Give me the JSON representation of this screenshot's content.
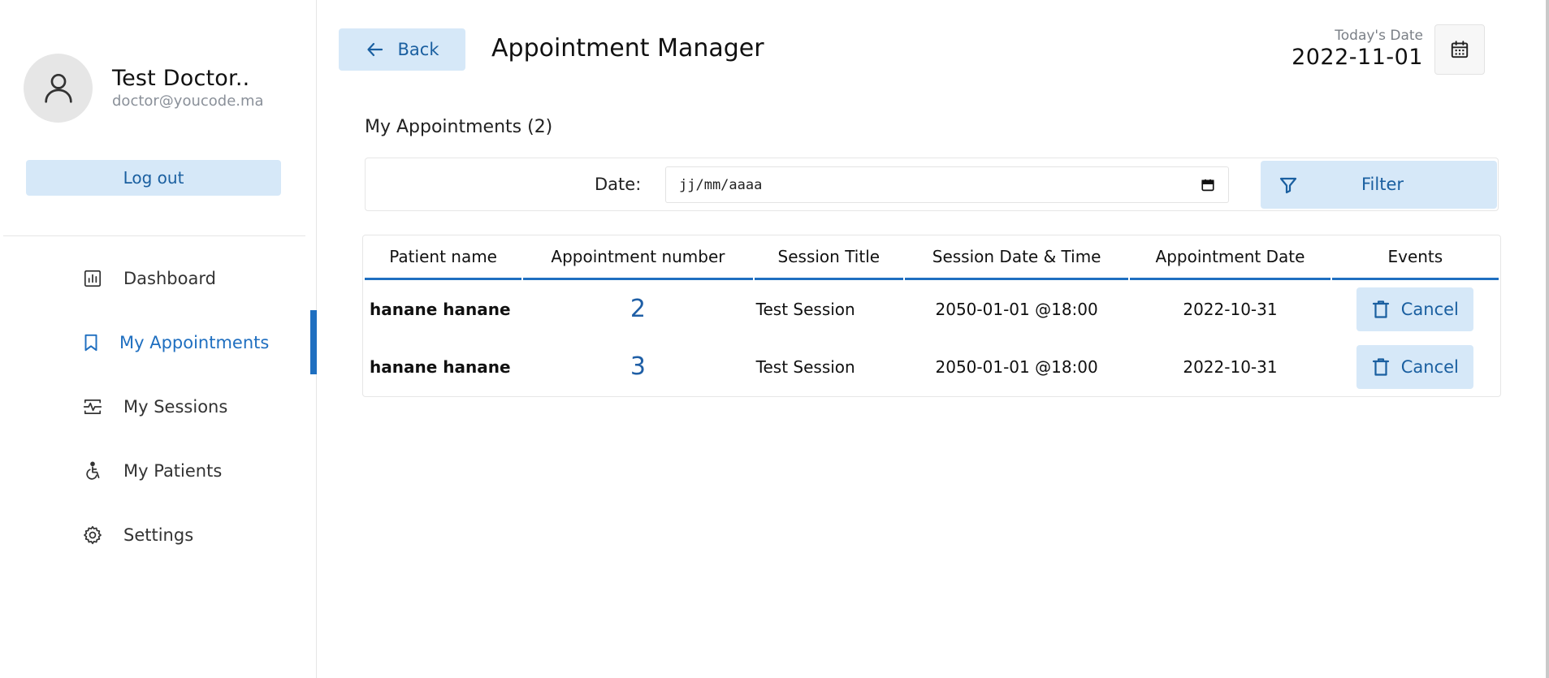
{
  "sidebar": {
    "profile": {
      "name": "Test Doctor..",
      "email": "doctor@youcode.ma"
    },
    "logout_label": "Log out",
    "items": [
      {
        "label": "Dashboard",
        "icon": "dashboard-icon",
        "active": false
      },
      {
        "label": "My Appointments",
        "icon": "bookmark-icon",
        "active": true
      },
      {
        "label": "My Sessions",
        "icon": "sessions-icon",
        "active": false
      },
      {
        "label": "My Patients",
        "icon": "wheelchair-icon",
        "active": false
      },
      {
        "label": "Settings",
        "icon": "gear-icon",
        "active": false
      }
    ]
  },
  "header": {
    "back_label": "Back",
    "title": "Appointment Manager",
    "today_label": "Today's Date",
    "today_date": "2022-11-01"
  },
  "main": {
    "section_title": "My Appointments (2)",
    "filter": {
      "date_label": "Date:",
      "date_placeholder": "jj/mm/aaaa",
      "button_label": "Filter"
    },
    "table": {
      "columns": [
        "Patient name",
        "Appointment number",
        "Session Title",
        "Session Date & Time",
        "Appointment Date",
        "Events"
      ],
      "rows": [
        {
          "patient": "hanane hanane",
          "number": "2",
          "session_title": "Test Session",
          "session_datetime": "2050-01-01 @18:00",
          "appointment_date": "2022-10-31",
          "action": "Cancel"
        },
        {
          "patient": "hanane hanane",
          "number": "3",
          "session_title": "Test Session",
          "session_datetime": "2050-01-01 @18:00",
          "appointment_date": "2022-10-31",
          "action": "Cancel"
        }
      ]
    }
  },
  "colors": {
    "accent": "#1f6fc0",
    "button_bg": "#d6e8f8",
    "button_text": "#1a5fa0"
  }
}
